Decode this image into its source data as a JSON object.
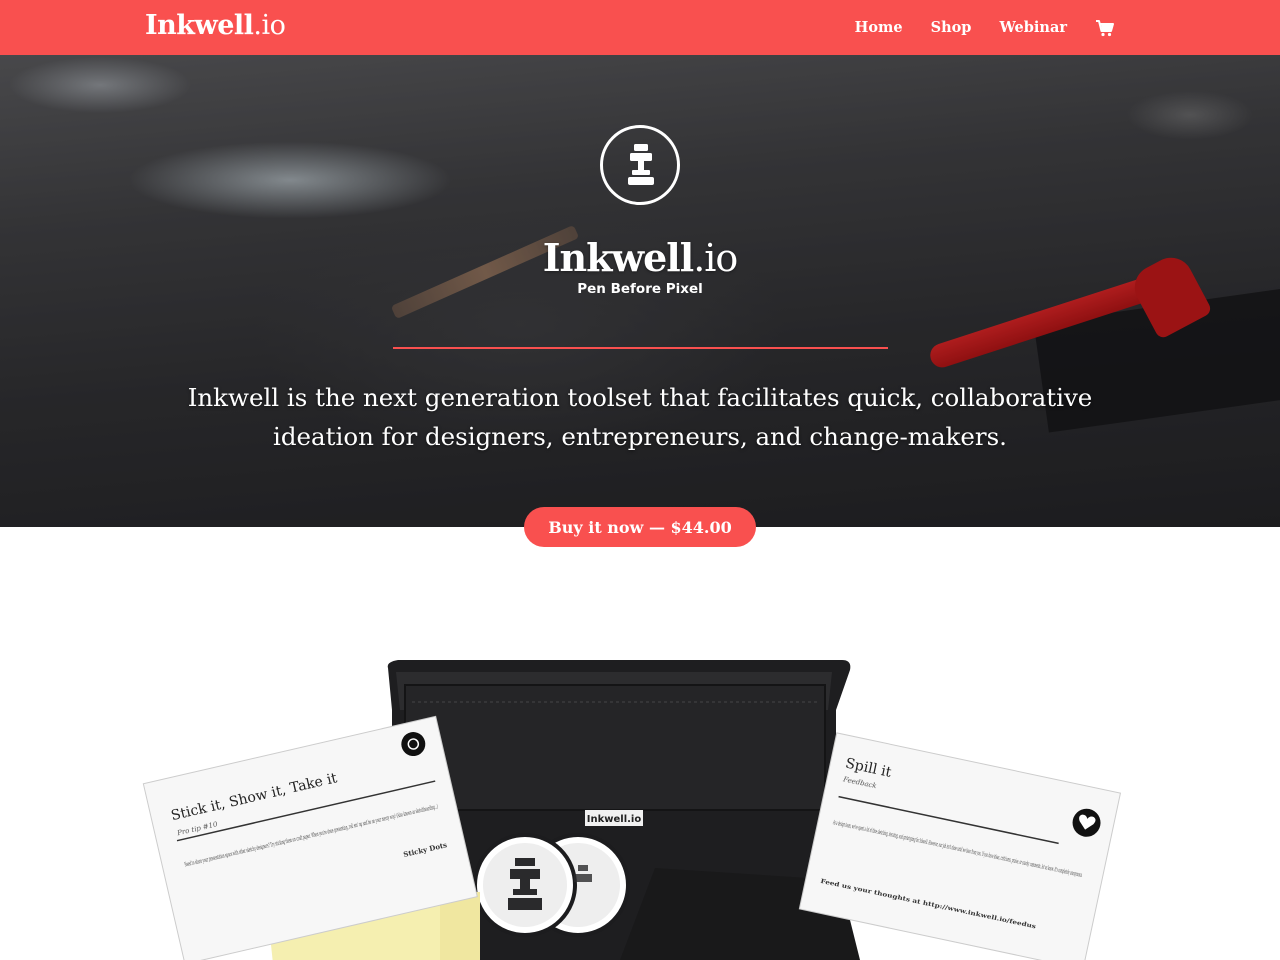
{
  "header": {
    "brand_name": "Inkwell",
    "brand_tld": ".io",
    "nav": [
      {
        "label": "Home"
      },
      {
        "label": "Shop"
      },
      {
        "label": "Webinar"
      }
    ],
    "cart_icon": "shopping-cart-icon",
    "background_color": "#f9504f"
  },
  "hero": {
    "logo_icon": "inkwell-stamp-icon",
    "title_name": "Inkwell",
    "title_tld": ".io",
    "tagline": "Pen Before Pixel",
    "description": "Inkwell is the next generation toolset that facilitates quick, collaborative ideation for designers, entrepreneurs, and change-makers.",
    "cta_label": "Buy it now — $44.00",
    "accent_color": "#f9504f"
  },
  "product": {
    "left_card": {
      "title": "Stick it, Show it, Take it",
      "subtitle": "Pro tip #10",
      "body": "Need to share your presentation space with other sketchy designers? Try sticking them on craft paper. When you're done presenting, roll em' up and be on your merry way! (Also known as sketchboarding...)",
      "tag": "Sticky Dots",
      "icon": "inkwell-logo-icon"
    },
    "pouch_label": "Inkwell.io",
    "right_card": {
      "title": "Spill it",
      "subtitle": "Feedback",
      "body": "As a design team, we've spent a lot of time sketching, iterating, and prototyping for Inkwell. However, our job isn't done until we hear from you. If you have ideas, criticisms, praise, or snarky comments, let us know. It's completely anonymous.",
      "footer": "Feed us your thoughts at http://www.inkwell.io/feedus",
      "icon": "heart-icon"
    }
  }
}
